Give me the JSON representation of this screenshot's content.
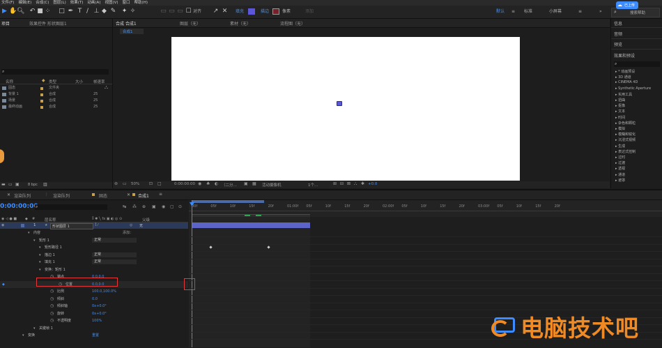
{
  "menu": [
    "文件(F)",
    "编辑(E)",
    "合成(C)",
    "图层(L)",
    "效果(T)",
    "动画(A)",
    "视图(V)",
    "窗口",
    "帮助(H)"
  ],
  "toolbar": {
    "align_label": "对齐",
    "fill_label": "填充",
    "stroke_label": "描边",
    "stroke_value": "像素",
    "add_label": "添加",
    "workspaces": [
      "默认",
      "标准",
      "小屏幕"
    ],
    "more": "»",
    "search_help": "搜索帮助",
    "badge_label": "已上传",
    "fill_color": "#5b57d8",
    "stroke_color": "#7a1f2a"
  },
  "project_panel": {
    "tab_project": "项目",
    "tab_effect_controls": "效果控件 形状图层1",
    "search_placeholder": "",
    "columns": {
      "name": "名称",
      "type": "类型",
      "size": "大小",
      "fps": "帧速率"
    },
    "items": [
      {
        "name": "固态",
        "type": "文件夹",
        "size": "",
        "fps": "",
        "color": "#c8a24a"
      },
      {
        "name": "背景 1",
        "type": "合成",
        "size": "",
        "fps": "25",
        "color": "#c8a24a"
      },
      {
        "name": "场景",
        "type": "合成",
        "size": "",
        "fps": "25",
        "color": "#c8a24a"
      },
      {
        "name": "最终动画",
        "type": "合成",
        "size": "",
        "fps": "25",
        "color": "#c8a24a"
      }
    ],
    "footer_depth": "8 bpc"
  },
  "viewer": {
    "tabs": [
      "合成 合成1",
      "图层（无）",
      "素材（无）",
      "流程图（无）"
    ],
    "comp_chip": "合成1",
    "zoom": "50%",
    "timecode": "0:00:00:00",
    "quality": "（二分…",
    "camera": "活动摄像机",
    "views": "1个…",
    "exposure": "+0.0"
  },
  "right_panel": {
    "sections": [
      "信息",
      "音频",
      "预览",
      "效果和预设"
    ],
    "search_placeholder": "",
    "effects": [
      "▸ * 动画预设",
      "▸ 3D 通道",
      "▸ CINEMA 4D",
      "▸ Synthetic Aperture",
      "▸ 实用工具",
      "▸ 扭曲",
      "▸ 抠像",
      "▸ 文本",
      "▸ 时间",
      "▸ 杂色和颗粒",
      "▸ 模拟",
      "▸ 模糊和锐化",
      "▸ 沉浸式视频",
      "▸ 生成",
      "▸ 表达式控制",
      "▸ 过时",
      "▸ 过渡",
      "▸ 透视",
      "▸ 通道",
      "▸ 遮罩"
    ]
  },
  "timeline": {
    "tabs": [
      "渲染队列",
      "渲染队列",
      "固态",
      "合成1"
    ],
    "timecode": "0:00:00:00",
    "columns": {
      "layer_name": "层名称",
      "parent": "父级"
    },
    "layer": {
      "index": "1",
      "name": "形状图层 1",
      "parent": "无"
    },
    "rows": [
      {
        "label": "内容",
        "value": "",
        "indent": 48
      },
      {
        "label": "矩形 1",
        "value": "正常",
        "indent": 56
      },
      {
        "label": "矩形路径 1",
        "value": "",
        "indent": 64
      },
      {
        "label": "描边 1",
        "value": "正常",
        "indent": 64
      },
      {
        "label": "填充 1",
        "value": "正常",
        "indent": 64
      },
      {
        "label": "变换：矩形 1",
        "value": "",
        "indent": 64
      },
      {
        "label": "锚点",
        "value": "0.0,0.0",
        "indent": 82
      },
      {
        "label": "位置",
        "value": "0.0,0.0",
        "indent": 94
      },
      {
        "label": "比例",
        "value": "100.0,100.0%",
        "indent": 82
      },
      {
        "label": "倾斜",
        "value": "0.0",
        "indent": 82
      },
      {
        "label": "倾斜轴",
        "value": "0x+0.0°",
        "indent": 82
      },
      {
        "label": "旋转",
        "value": "0x+0.0°",
        "indent": 82
      },
      {
        "label": "不透明度",
        "value": "100%",
        "indent": 82
      },
      {
        "label": "关键帧 1",
        "value": "",
        "indent": 56
      },
      {
        "label": "变换",
        "value": "重置",
        "indent": 40
      }
    ],
    "add_label": "添加：",
    "ruler": [
      "00f",
      "05f",
      "10f",
      "15f",
      "20f",
      "01:00f",
      "05f",
      "10f",
      "15f",
      "20f",
      "02:00f",
      "05f",
      "10f",
      "15f",
      "20f",
      "03:00f",
      "05f",
      "10f",
      "15f",
      "20f"
    ]
  },
  "watermark": {
    "text": "电脑技术吧"
  }
}
